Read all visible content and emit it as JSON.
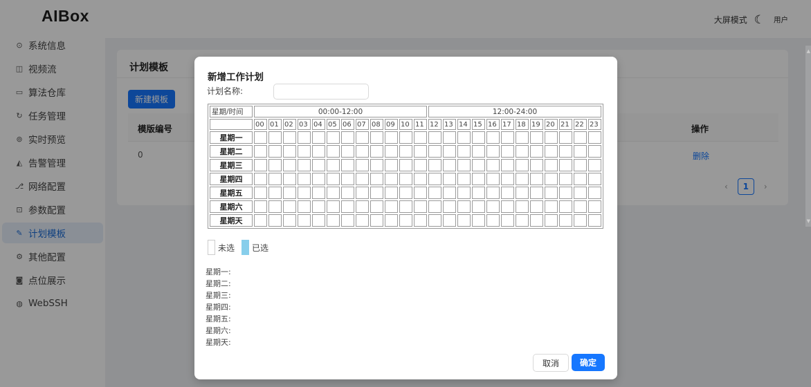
{
  "app": {
    "title": "AIBox"
  },
  "header": {
    "bigscreen_label": "大屏模式",
    "moon_icon": "moon-icon",
    "user_label": "用户"
  },
  "sidebar": {
    "items": [
      {
        "label": "系统信息",
        "icon": "info-circle-icon",
        "glyph": "⊙"
      },
      {
        "label": "视频流",
        "icon": "video-icon",
        "glyph": "◫"
      },
      {
        "label": "算法仓库",
        "icon": "algorithm-icon",
        "glyph": "▭"
      },
      {
        "label": "任务管理",
        "icon": "task-icon",
        "glyph": "↻"
      },
      {
        "label": "实时预览",
        "icon": "preview-icon",
        "glyph": "⊚"
      },
      {
        "label": "告警管理",
        "icon": "alarm-icon",
        "glyph": "◭"
      },
      {
        "label": "网络配置",
        "icon": "network-icon",
        "glyph": "⎇"
      },
      {
        "label": "参数配置",
        "icon": "params-icon",
        "glyph": "⊡"
      },
      {
        "label": "计划模板",
        "icon": "plan-icon",
        "glyph": "✎",
        "active": true
      },
      {
        "label": "其他配置",
        "icon": "settings-icon",
        "glyph": "⚙"
      },
      {
        "label": "点位展示",
        "icon": "camera-icon",
        "glyph": "◙"
      },
      {
        "label": "WebSSH",
        "icon": "globe-icon",
        "glyph": "◍"
      }
    ]
  },
  "page": {
    "title": "计划模板",
    "new_button": "新建模板",
    "columns": [
      "模版编号",
      "操作"
    ],
    "rows": [
      {
        "id": "0",
        "action": "删除"
      }
    ],
    "pagination": {
      "prev": "‹",
      "current": "1",
      "next": "›"
    }
  },
  "modal": {
    "title": "新增工作计划",
    "name_label": "计划名称:",
    "name_value": "",
    "grid": {
      "corner": "星期/时间",
      "halves": [
        "00:00-12:00",
        "12:00-24:00"
      ],
      "hours": [
        "00",
        "01",
        "02",
        "03",
        "04",
        "05",
        "06",
        "07",
        "08",
        "09",
        "10",
        "11",
        "12",
        "13",
        "14",
        "15",
        "16",
        "17",
        "18",
        "19",
        "20",
        "21",
        "22",
        "23"
      ],
      "days": [
        "星期一",
        "星期二",
        "星期三",
        "星期四",
        "星期五",
        "星期六",
        "星期天"
      ]
    },
    "legend": {
      "unselected": "未选",
      "selected": "已选",
      "selected_color": "#87ceeb"
    },
    "summary": [
      "星期一:",
      "星期二:",
      "星期三:",
      "星期四:",
      "星期五:",
      "星期六:",
      "星期天:"
    ],
    "cancel": "取消",
    "ok": "确定"
  },
  "colors": {
    "primary": "#1677ff",
    "active_bg": "#e7effa"
  }
}
